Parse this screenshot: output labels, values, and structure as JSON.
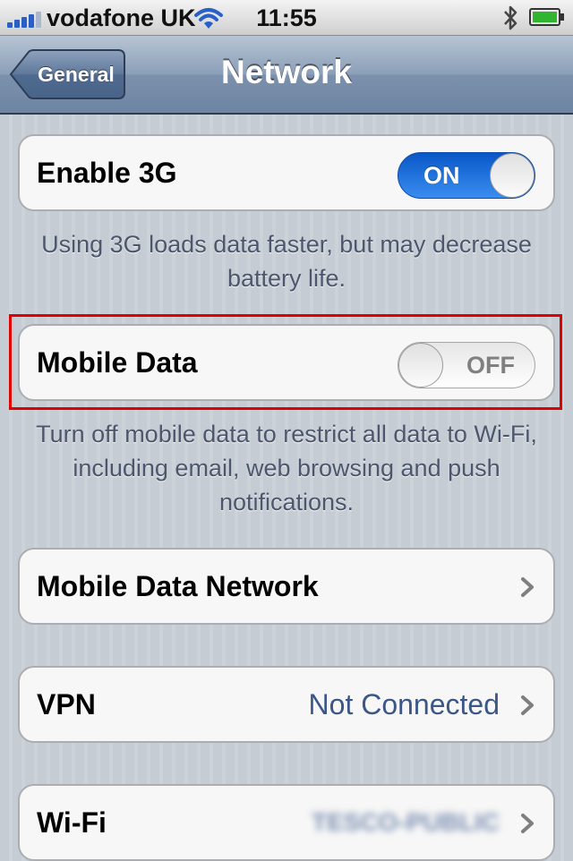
{
  "status_bar": {
    "carrier": "vodafone UK",
    "time": "11:55",
    "icons": [
      "signal-icon",
      "wifi-icon",
      "bluetooth-icon",
      "battery-icon"
    ]
  },
  "nav": {
    "back_label": "General",
    "title": "Network"
  },
  "cells": {
    "enable_3g": {
      "label": "Enable 3G",
      "switch": "ON"
    },
    "enable_3g_footer": "Using 3G loads data faster, but may decrease battery life.",
    "mobile_data": {
      "label": "Mobile Data",
      "switch": "OFF"
    },
    "mobile_data_footer": "Turn off mobile data to restrict all data to Wi-Fi, including email, web browsing and push notifications.",
    "mobile_data_network": {
      "label": "Mobile Data Network"
    },
    "vpn": {
      "label": "VPN",
      "value": "Not Connected"
    },
    "wifi": {
      "label": "Wi-Fi",
      "value": "TESCO-PUBLIC"
    }
  },
  "colors": {
    "switch_on": "#1a6fe0",
    "highlight": "#e00000",
    "detail_text": "#3b5687"
  }
}
